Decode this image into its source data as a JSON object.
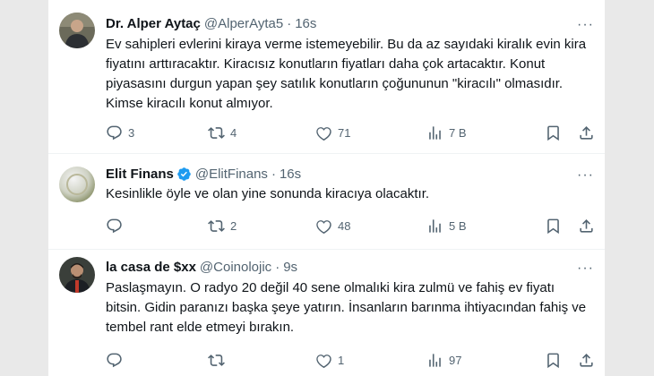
{
  "tweets": [
    {
      "name": "Dr. Alper Aytaç",
      "handle": "@AlperAyta5",
      "time": "16s",
      "text": "Ev sahipleri evlerini kiraya verme istemeyebilir. Bu da az sayıdaki kiralık evin kira fiyatını arttıracaktır. Kiracısız konutların fiyatları daha çok artacaktır. Konut piyasasını durgun yapan şey satılık konutların çoğununun \"kiracılı\" olmasıdır. Kimse kiracılı konut almıyor.",
      "verified": false,
      "replies": "3",
      "retweets": "4",
      "likes": "71",
      "views": "7 B"
    },
    {
      "name": "Elit Finans",
      "handle": "@ElitFinans",
      "time": "16s",
      "text": "Kesinlikle öyle ve olan yine sonunda kiracıya olacaktır.",
      "verified": true,
      "replies": "",
      "retweets": "2",
      "likes": "48",
      "views": "5 B"
    },
    {
      "name": "la casa de $xx",
      "handle": "@Coinolojic",
      "time": "9s",
      "text": "Paslaşmayın. O radyo 20 değil 40 sene olmalıki kira zulmü ve fahiş ev fiyatı bitsin. Gidin paranızı başka şeye yatırın. İnsanların barınma ihtiyacından fahiş ve tembel rant elde etmeyi bırakın.",
      "verified": false,
      "replies": "",
      "retweets": "",
      "likes": "1",
      "views": "97"
    }
  ],
  "separator": "·",
  "more_icon": "···",
  "colors": {
    "text": "#0f1419",
    "secondary": "#536471",
    "verified": "#1d9bf0",
    "background": "#e9e9e9",
    "divider": "#eff3f4"
  },
  "icons": [
    "reply-icon",
    "retweet-icon",
    "like-icon",
    "views-icon",
    "bookmark-icon",
    "share-icon",
    "verified-icon",
    "more-icon"
  ]
}
